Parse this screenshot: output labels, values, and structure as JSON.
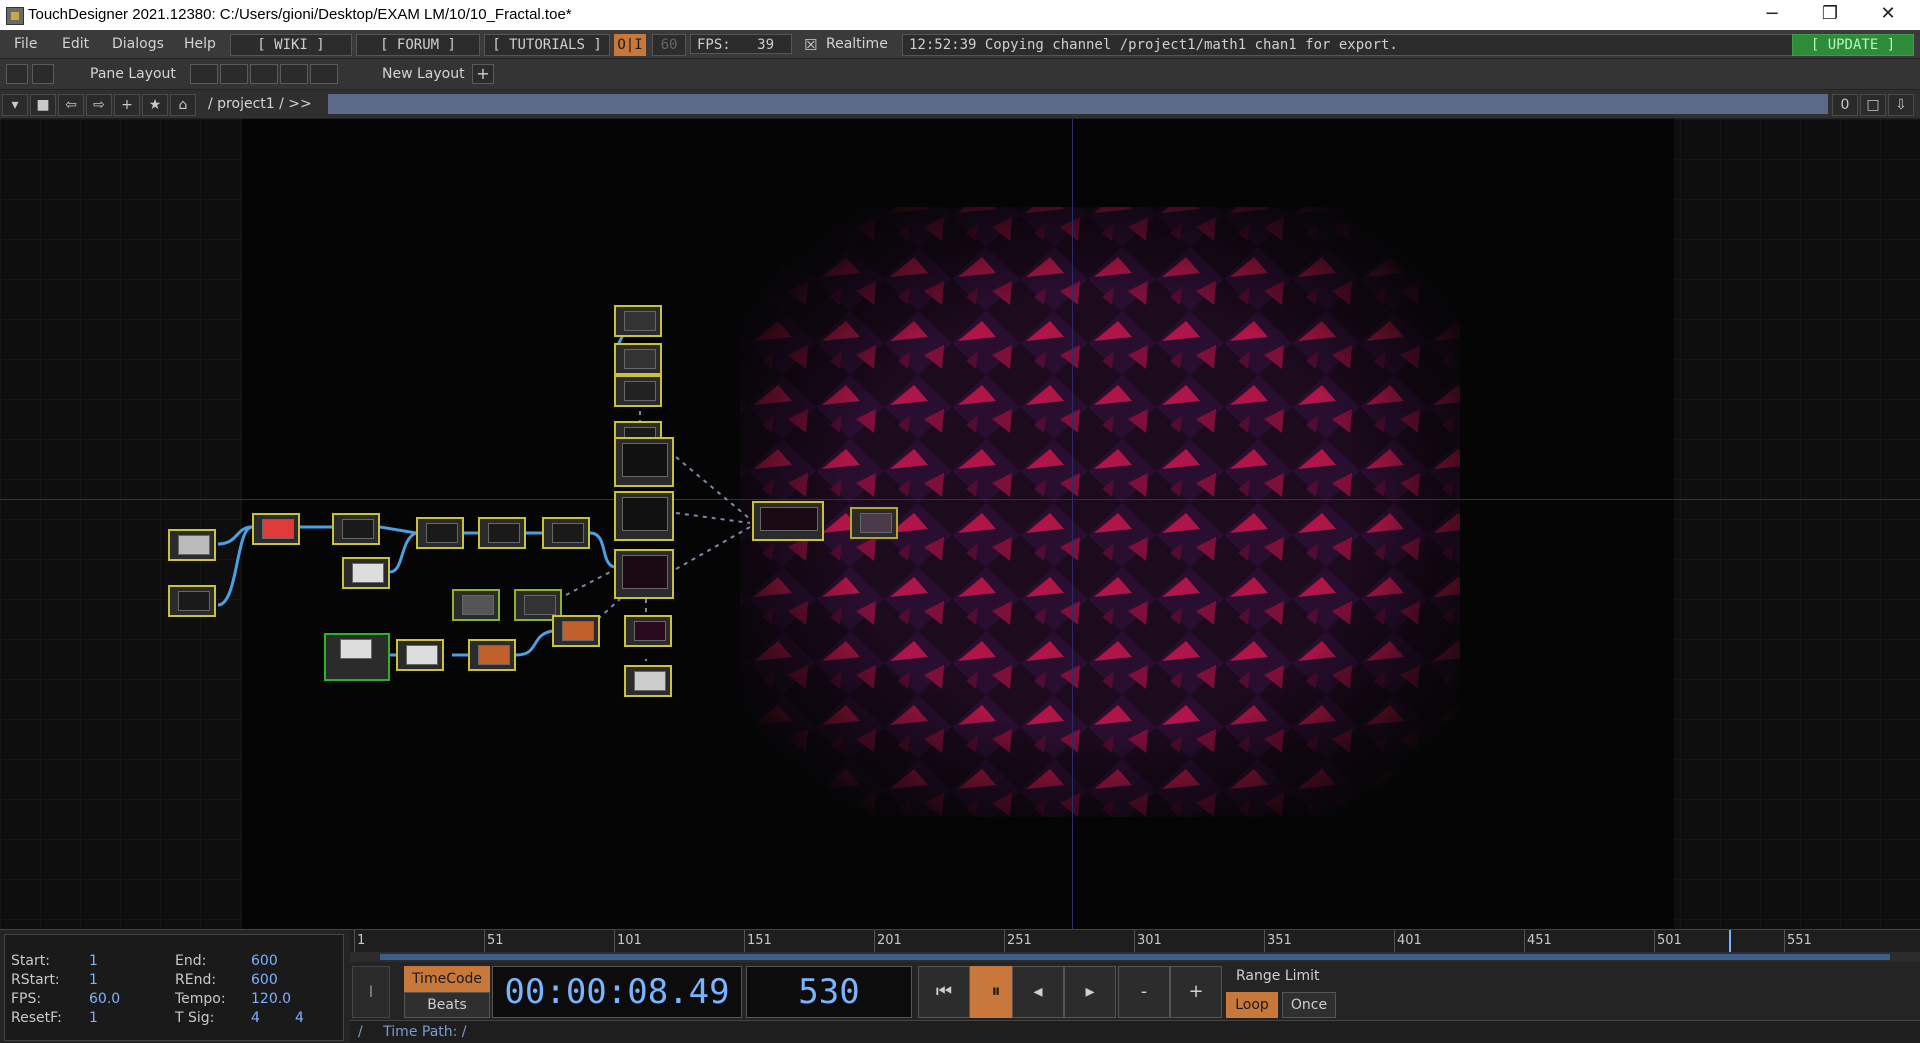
{
  "window": {
    "title": "TouchDesigner 2021.12380: C:/Users/gioni/Desktop/EXAM LM/10/10_Fractal.toe*",
    "controls": {
      "minimize": "−",
      "restore": "❐",
      "close": "✕"
    }
  },
  "menubar": {
    "file": "File",
    "edit": "Edit",
    "dialogs": "Dialogs",
    "help": "Help",
    "wiki": "[ WIKI ]",
    "forum": "[ FORUM ]",
    "tutorials": "[ TUTORIALS ]",
    "oi": "O|I",
    "fps_target": "60",
    "fps_label": "FPS:",
    "fps_value": "39",
    "realtime_label": "Realtime",
    "realtime_check": "☒",
    "status": "12:52:39 Copying channel /project1/math1 chan1 for export.",
    "update": "[ UPDATE ]"
  },
  "layoutbar": {
    "pane_layout": "Pane Layout",
    "new_layout": "New Layout",
    "add": "+"
  },
  "pathbar": {
    "path": "/ project1 / >>",
    "right_value": "0"
  },
  "timeline": {
    "start_label": "Start:",
    "start_value": "1",
    "end_label": "End:",
    "end_value": "600",
    "rstart_label": "RStart:",
    "rstart_value": "1",
    "rend_label": "REnd:",
    "rend_value": "600",
    "fps_label": "FPS:",
    "fps_value": "60.0",
    "tempo_label": "Tempo:",
    "tempo_value": "120.0",
    "resetf_label": "ResetF:",
    "resetf_value": "1",
    "tsig_label": "T Sig:",
    "tsig_a": "4",
    "tsig_b": "4",
    "ticks": [
      "1",
      "51",
      "101",
      "151",
      "201",
      "251",
      "301",
      "351",
      "401",
      "451",
      "501",
      "551"
    ],
    "timecode_btn": "TimeCode",
    "beats_btn": "Beats",
    "timecode": "00:00:08.49",
    "frame": "530",
    "range_limit": "Range Limit",
    "loop": "Loop",
    "once": "Once",
    "minus": "-",
    "plus": "+",
    "time_path_slash": "/",
    "time_path": "Time Path: /"
  },
  "accent": "#c8783a",
  "value_color": "#7ab4ff"
}
